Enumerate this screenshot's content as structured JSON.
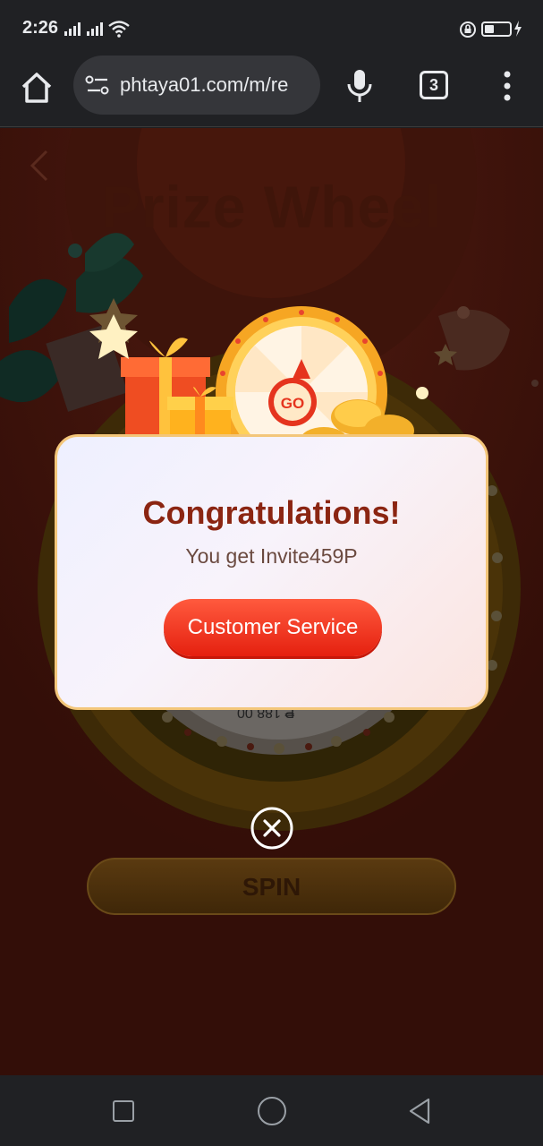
{
  "status_bar": {
    "time": "2:26"
  },
  "browser": {
    "url": "phtaya01.com/m/re",
    "tab_count": "3"
  },
  "page": {
    "title": "Prize Wheel",
    "wheel_center_label": "GO",
    "visible_prize": "₱ 188.00",
    "spin_label": "SPIN"
  },
  "modal": {
    "title": "Congratulations!",
    "message": "You get Invite459P",
    "button_label": "Customer Service"
  },
  "colors": {
    "page_bg": "#330e08",
    "title_text": "#8b2512",
    "cta_red": "#e5200f",
    "modal_border": "#f3c67a",
    "wheel_gold": "#f6a623"
  }
}
